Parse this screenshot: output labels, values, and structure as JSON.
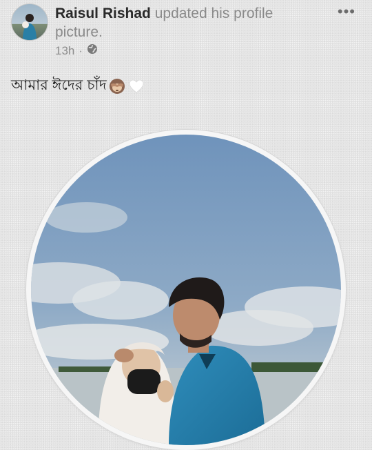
{
  "post": {
    "author": "Raisul Rishad",
    "action": "updated his profile picture.",
    "time": "13h",
    "privacy_icon": "globe-icon",
    "more_icon": "more-options-icon",
    "more_label": "•••",
    "caption": "আমার ঈদের চাঁদ",
    "caption_emojis": [
      "see-no-evil-monkey-icon",
      "white-heart-icon"
    ]
  }
}
